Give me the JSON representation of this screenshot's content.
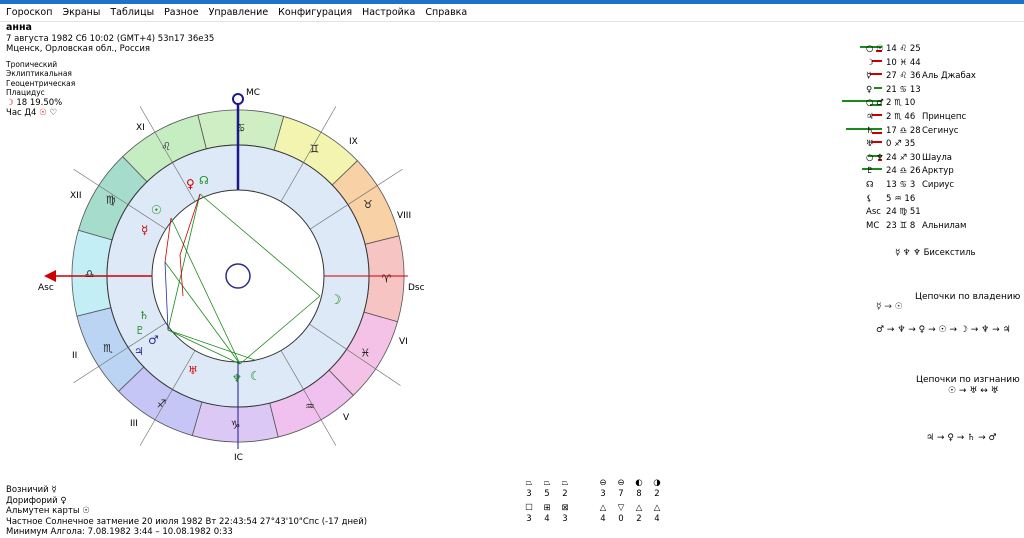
{
  "menu": [
    "Гороскоп",
    "Экраны",
    "Таблицы",
    "Разное",
    "Управление",
    "Конфигурация",
    "Настройка",
    "Справка"
  ],
  "info": {
    "name": "анна",
    "datetime": "7 августа 1982  Сб  10:02 (GMT+4) 53n17  36e35",
    "place": "Мценск, Орловская обл., Россия",
    "zodiac": "Тропический",
    "coords": "Эклиптикальная",
    "center": "Геоцентрическая",
    "houses": "Плацидус",
    "moon_phase": "18 19.50%",
    "hour": "Час Д4"
  },
  "wheel": {
    "labels": {
      "mc": "MC",
      "ic": "IC",
      "asc": "Asc",
      "dsc": "Dsc"
    },
    "houses": [
      "XI",
      "XII",
      "II",
      "III",
      "V",
      "VI",
      "VIII",
      "IX"
    ],
    "signs": [
      "♋",
      "♊",
      "♉",
      "♈",
      "♓",
      "♒",
      "♑",
      "♐",
      "♏",
      "♎",
      "♍",
      "♌"
    ],
    "sign_colors": [
      "#cfeec4",
      "#f2f4b0",
      "#f8d2a6",
      "#f7c4c4",
      "#f4c2e6",
      "#f0c0ee",
      "#dcc8f4",
      "#c6c6f6",
      "#bcd4f4",
      "#c4eef6",
      "#a6dccb",
      "#c6ecc2"
    ]
  },
  "planets": [
    {
      "glyph": "○ ☉",
      "pos": "14 ♌ 25",
      "star": ""
    },
    {
      "glyph": "☽",
      "pos": "10 ♓ 44",
      "star": ""
    },
    {
      "glyph": "☿",
      "pos": "27 ♌ 36",
      "star": "Аль Джабах"
    },
    {
      "glyph": "♀",
      "pos": "21 ♋ 13",
      "star": ""
    },
    {
      "glyph": "○ ♂",
      "pos": "2 ♏ 10",
      "star": ""
    },
    {
      "glyph": "♃",
      "pos": "2 ♏ 46",
      "star": "Принцепс"
    },
    {
      "glyph": "♄",
      "pos": "17 ♎ 28",
      "star": "Сегинус"
    },
    {
      "glyph": "♅",
      "pos": "0 ♐ 35",
      "star": ""
    },
    {
      "glyph": "○ ♆",
      "pos": "24 ♐ 30",
      "star": "Шаула"
    },
    {
      "glyph": "♇",
      "pos": "24 ♎ 26",
      "star": "Арктур"
    },
    {
      "glyph": "☊",
      "pos": "13 ♋ 3",
      "star": "Сириус"
    },
    {
      "glyph": "⚸",
      "pos": "5 ♒ 16",
      "star": ""
    },
    {
      "glyph": "Asc",
      "pos": "24 ♍ 51",
      "star": ""
    },
    {
      "glyph": "MC",
      "pos": "23 ♊ 8",
      "star": "Альнилам"
    }
  ],
  "bisextile": "☿ ♆ ♆  Бисекстиль",
  "chains": {
    "ownership_title": "Цепочки по владению",
    "ownership_line1": "☿ → ☉",
    "ownership_line2": "♂ → ♆ → ♀ → ☉ → ☽ → ♆ → ♃",
    "exile_title": "Цепочки по изгнанию",
    "exile_line1": "☉ → ♅ ↔ ♅",
    "exile_line2": "♃ → ♀ → ♄ → ♂"
  },
  "bottom": {
    "vozn": "Возничий  ☿",
    "dorif": "Дорифорий  ♀",
    "almuten": "Альмутен карты  ☉",
    "eclipse": "Частное Солнечное затмение 20 июля 1982 Вт 22:43:54 27°43'10\"Спс (-17 дней)",
    "minimum": "Минимум Алгола: 7.08.1982  3:44 – 10.08.1982  0:33"
  },
  "aspects": {
    "row1": [
      "3",
      "5",
      "2",
      "",
      "3",
      "7",
      "8",
      "2"
    ],
    "row2": [
      "3",
      "4",
      "3",
      "",
      "4",
      "0",
      "2",
      "4"
    ]
  }
}
